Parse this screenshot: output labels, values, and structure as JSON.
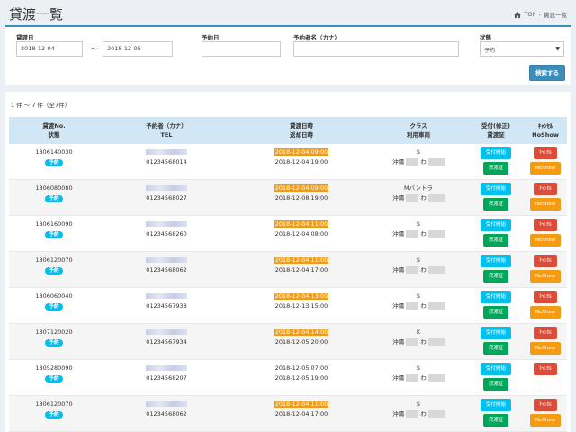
{
  "header": {
    "title": "貸渡一覧",
    "breadcrumb": [
      "TOP",
      "貸渡一覧"
    ]
  },
  "filter": {
    "lend_date_label": "貸渡日",
    "lend_date_from": "2018-12-04",
    "range_sep": "～",
    "lend_date_to": "2018-12-05",
    "reserve_date_label": "予約日",
    "reserve_date_value": "",
    "name_label": "予約者名（カナ）",
    "name_value": "",
    "status_label": "状態",
    "status_value": "予約",
    "search_button": "検索する"
  },
  "results": {
    "count_text": "1 件 ～ 7 件（全7件）",
    "headers": {
      "no": [
        "貸渡No.",
        "状態"
      ],
      "name": [
        "予約者（カナ）",
        "TEL"
      ],
      "date": [
        "貸渡日時",
        "返却日時"
      ],
      "class": [
        "クラス",
        "利用車両"
      ],
      "accept": [
        "受付(修正)",
        "貸渡証"
      ],
      "cancel": [
        "ｷｬﾝｾﾙ",
        "NoShow"
      ]
    },
    "rows": [
      {
        "no": "1806140030",
        "status": "予約",
        "tel": "01234568014",
        "lend": "2018-12-04 09:00",
        "ret": "2018-12-04 19:00",
        "cls": "S",
        "car_pref": "沖縄",
        "car_mid": "わ",
        "btn_accept": "受付開始",
        "btn_cert": "貸渡証",
        "btn_cancel": "ｷｬﾝｾﾙ",
        "btn_noshow": "NoShow"
      },
      {
        "no": "1806080080",
        "status": "予約",
        "tel": "01234568027",
        "lend": "2018-12-04 09:00",
        "ret": "2018-12-08 19:00",
        "cls": "Mバントラ",
        "car_pref": "沖縄",
        "car_mid": "わ",
        "btn_accept": "受付開始",
        "btn_cert": "貸渡証",
        "btn_cancel": "ｷｬﾝｾﾙ",
        "btn_noshow": "NoShow"
      },
      {
        "no": "1806160090",
        "status": "予約",
        "tel": "01234568260",
        "lend": "2018-12-04 11:00",
        "ret": "2018-12-04 08:00",
        "cls": "S",
        "car_pref": "沖縄",
        "car_mid": "わ",
        "btn_accept": "受付開始",
        "btn_cert": "貸渡証",
        "btn_cancel": "ｷｬﾝｾﾙ",
        "btn_noshow": "NoShow"
      },
      {
        "no": "1806120070",
        "status": "予約",
        "tel": "01234568062",
        "lend": "2018-12-04 11:00",
        "ret": "2018-12-04 17:00",
        "cls": "S",
        "car_pref": "沖縄",
        "car_mid": "わ",
        "btn_accept": "受付開始",
        "btn_cert": "貸渡証",
        "btn_cancel": "ｷｬﾝｾﾙ",
        "btn_noshow": "NoShow"
      },
      {
        "no": "1806060040",
        "status": "予約",
        "tel": "01234567938",
        "lend": "2018-12-04 13:00",
        "ret": "2018-12-13 15:00",
        "cls": "S",
        "car_pref": "沖縄",
        "car_mid": "わ",
        "btn_accept": "受付開始",
        "btn_cert": "貸渡証",
        "btn_cancel": "ｷｬﾝｾﾙ",
        "btn_noshow": "NoShow"
      },
      {
        "no": "1807120020",
        "status": "予約",
        "tel": "01234567934",
        "lend": "2018-12-04 14:00",
        "ret": "2018-12-05 20:00",
        "cls": "K",
        "car_pref": "沖縄",
        "car_mid": "わ",
        "btn_accept": "受付開始",
        "btn_cert": "貸渡証",
        "btn_cancel": "ｷｬﾝｾﾙ",
        "btn_noshow": "NoShow"
      },
      {
        "no": "1805280090",
        "status": "予約",
        "tel": "01234568207",
        "lend": "2018-12-05 07:00",
        "ret": "2018-12-05 19:00",
        "cls": "S",
        "car_pref": "沖縄",
        "car_mid": "わ",
        "btn_accept": "受付開始",
        "btn_cert": "貸渡証",
        "btn_cancel": "ｷｬﾝｾﾙ"
      },
      {
        "no": "1806120070",
        "status": "予約",
        "tel": "01234568062",
        "lend": "2018-12-04 11:00",
        "ret": "2018-12-04 17:00",
        "cls": "S",
        "car_pref": "沖縄",
        "car_mid": "わ",
        "btn_accept": "受付開始",
        "btn_cert": "貸渡証",
        "btn_cancel": "ｷｬﾝｾﾙ",
        "btn_noshow": "NoShow"
      }
    ]
  },
  "colors": {
    "accent": "#3c8dbc",
    "highlight": "#f39c12",
    "info": "#00c0ef",
    "success": "#00a65a",
    "danger": "#dd4b39"
  },
  "icons": {
    "breadcrumb_home": "home-icon"
  }
}
